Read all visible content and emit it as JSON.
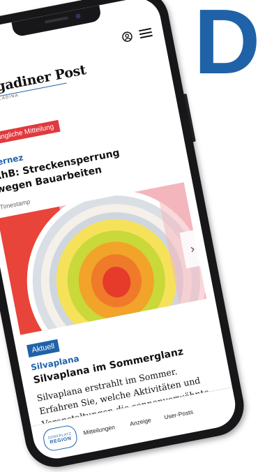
{
  "background_letter": "D",
  "colors": {
    "brand_blue": "#1f62a8",
    "urgent_red": "#e03a3e",
    "phone_frame": "#17171a"
  },
  "header": {
    "logo": "Engadiner Post",
    "logo_sub": "POSTA LADINA",
    "icons": [
      "user-icon",
      "hamburger-menu-icon"
    ]
  },
  "article1": {
    "badge": "Dringliche Mitteilung",
    "kicker": "Zernez",
    "headline": "RhB: Streckensperrung wegen Bauarbeiten",
    "timestamp": "Timestamp"
  },
  "carousel": {
    "next_icon": "chevron-right-icon"
  },
  "article2": {
    "badge": "Aktuell",
    "kicker": "Silvaplana",
    "headline": "Silvaplana im Sommerglanz",
    "teaser": "Silvaplana erstrahlt im Sommer. Erfahren Sie, welche Aktivitäten und Veranstaltungen die sonnenverwöhnte Gemeinde zu bieten hat..."
  },
  "bottom_nav": {
    "region_line1": "DORFPLATZ",
    "region_line2": "REGION",
    "items": [
      "Mitteilungen",
      "Anzeige",
      "User-Posts"
    ]
  }
}
